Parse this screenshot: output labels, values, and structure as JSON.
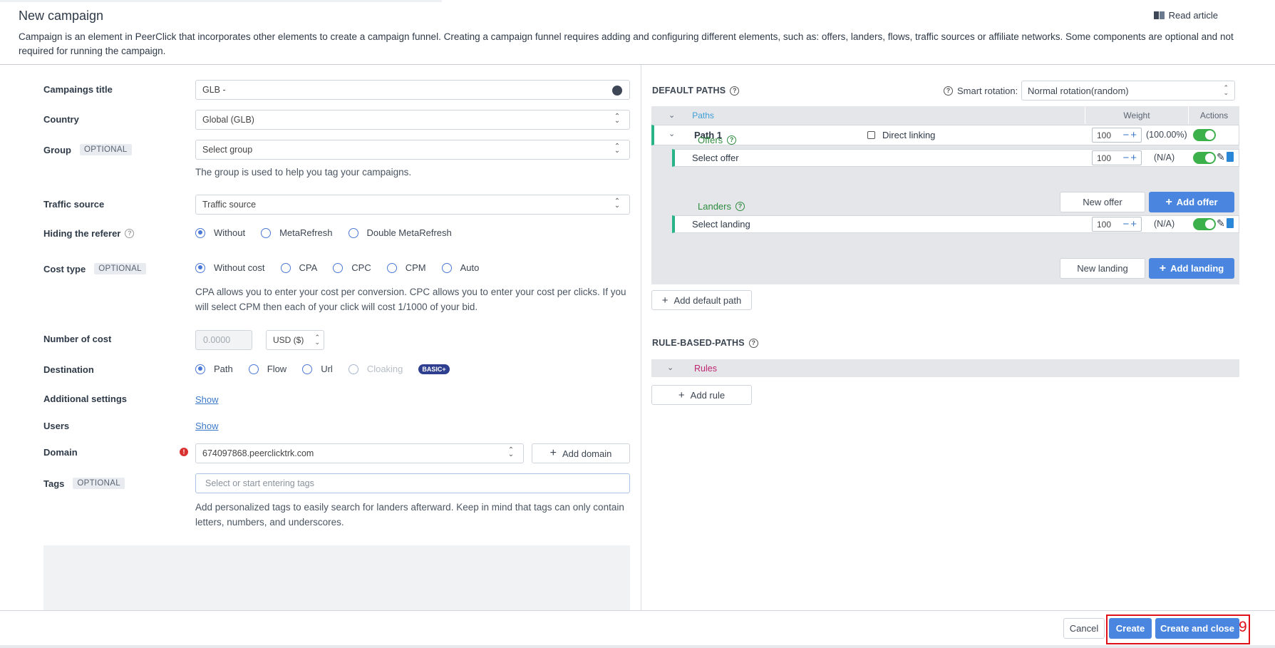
{
  "header": {
    "title": "New campaign",
    "read_article": "Read article",
    "intro": "Campaign is an element in PeerClick that incorporates other elements to create a campaign funnel. Creating a campaign funnel requires adding and configuring different elements, such as: offers, landers, flows, traffic sources or affiliate networks. Some components are optional and not required for running the campaign."
  },
  "form": {
    "title_label": "Campaings title",
    "title_value": "GLB -",
    "country_label": "Country",
    "country_value": "Global (GLB)",
    "group_label": "Group",
    "optional": "OPTIONAL",
    "group_placeholder": "Select group",
    "group_help": "The group is used to help you tag your campaigns.",
    "traffic_label": "Traffic source",
    "traffic_value": "Traffic source",
    "referer_label": "Hiding the referer",
    "referer_options": [
      "Without",
      "MetaRefresh",
      "Double MetaRefresh"
    ],
    "cost_label": "Cost type",
    "cost_options": [
      "Without cost",
      "CPA",
      "CPC",
      "CPM",
      "Auto"
    ],
    "cost_help": "CPA allows you to enter your cost per conversion. CPC allows you to enter your cost per clicks. If you will select CPM then each of your click will cost 1/1000 of your bid.",
    "number_cost_label": "Number of cost",
    "number_cost_value": "0.0000",
    "currency": "USD ($)",
    "destination_label": "Destination",
    "destination_options": [
      "Path",
      "Flow",
      "Url",
      "Cloaking"
    ],
    "basic_badge": "BASIC+",
    "additional_label": "Additional settings",
    "users_label": "Users",
    "show": "Show",
    "domain_label": "Domain",
    "domain_value": "674097868.peerclicktrk.com",
    "add_domain": "Add domain",
    "tags_label": "Tags",
    "tags_placeholder": "Select or start entering tags",
    "tags_help": "Add personalized tags to easily search for landers afterward. Keep in mind that tags can only contain letters, numbers, and underscores."
  },
  "paths": {
    "default_heading": "DEFAULT PATHS",
    "smart_label": "Smart rotation:",
    "smart_value": "Normal rotation(random)",
    "col_paths": "Paths",
    "col_weight": "Weight",
    "col_actions": "Actions",
    "path1": "Path 1",
    "direct_linking": "Direct linking",
    "path1_weight": "100",
    "path1_pct": "(100.00%)",
    "offers": "Offers",
    "select_offer": "Select offer",
    "offer_weight": "100",
    "offer_pct": "(N/A)",
    "new_offer": "New offer",
    "add_offer": "Add offer",
    "landers": "Landers",
    "select_landing": "Select landing",
    "landing_weight": "100",
    "landing_pct": "(N/A)",
    "new_landing": "New landing",
    "add_landing": "Add landing",
    "add_default_path": "Add default path",
    "rule_heading": "RULE-BASED-PATHS",
    "rules": "Rules",
    "add_rule": "Add rule"
  },
  "footer": {
    "cancel": "Cancel",
    "create": "Create",
    "create_close": "Create and close",
    "marker": "9"
  },
  "colors": {
    "accent": "#4a86e0",
    "toggle_on": "#3cb04a",
    "path_stripe": "#28b487",
    "highlight": "#e0101a"
  }
}
